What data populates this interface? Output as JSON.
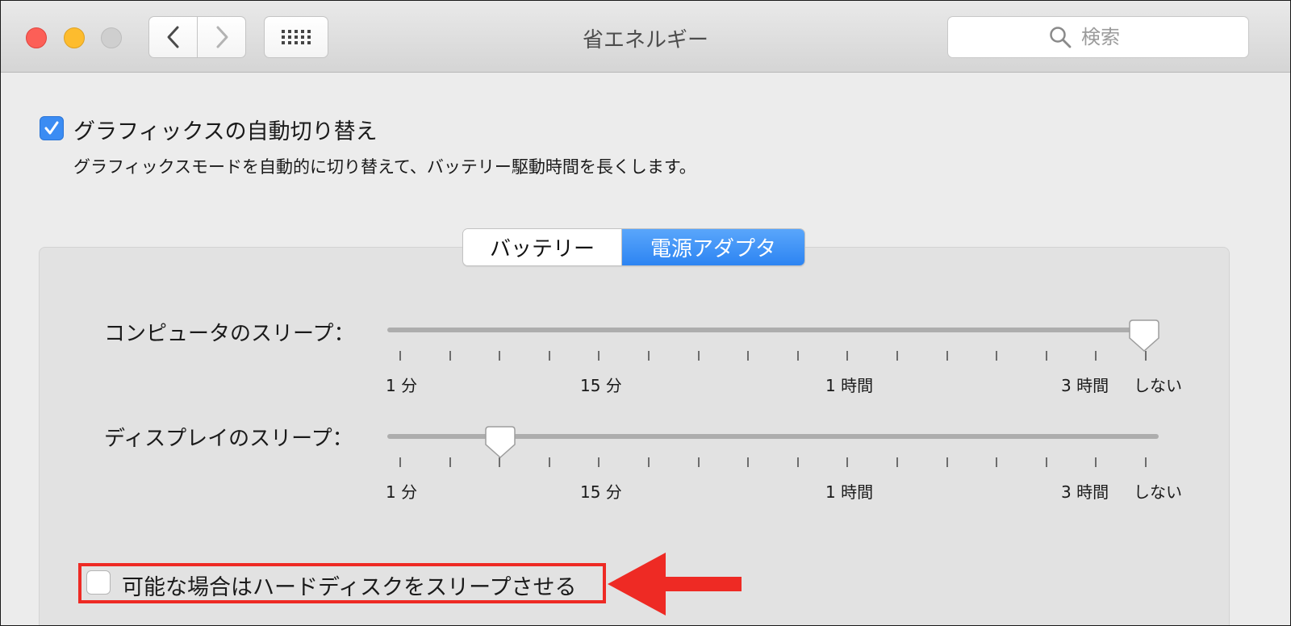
{
  "window": {
    "title": "省エネルギー",
    "search_placeholder": "検索"
  },
  "graphics_switching": {
    "checked": true,
    "label": "グラフィックスの自動切り替え",
    "description": "グラフィックスモードを自動的に切り替えて、バッテリー駆動時間を長くします。"
  },
  "tabs": [
    {
      "label": "バッテリー",
      "selected": false
    },
    {
      "label": "電源アダプタ",
      "selected": true
    }
  ],
  "computer_sleep": {
    "label": "コンピュータのスリープ：",
    "value": "しない"
  },
  "display_sleep": {
    "label": "ディスプレイのスリープ：",
    "value": "10 分"
  },
  "scale_labels": [
    "1 分",
    "15 分",
    "1 時間",
    "3 時間",
    "しない"
  ],
  "hard_disk_sleep": {
    "checked": false,
    "label": "可能な場合はハードディスクをスリープさせる"
  },
  "colors": {
    "accent": "#3b8cf3",
    "highlight": "#ee2a24"
  }
}
